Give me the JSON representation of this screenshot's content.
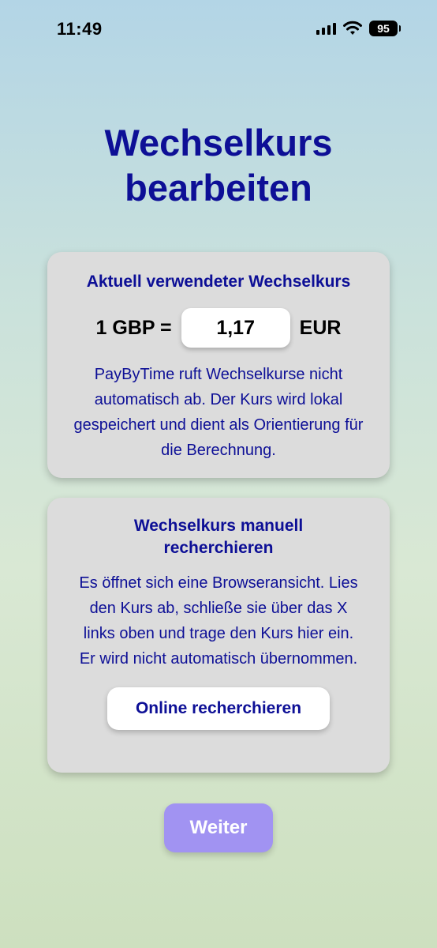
{
  "status_bar": {
    "time": "11:49",
    "battery": "95",
    "icons": [
      "signal-icon",
      "wifi-icon",
      "battery-icon"
    ]
  },
  "page": {
    "title_line1": "Wechselkurs",
    "title_line2": "bearbeiten"
  },
  "rate_card": {
    "heading": "Aktuell verwendeter Wechselkurs",
    "from_label": "1 GBP =",
    "rate_value": "1,17",
    "to_label": "EUR",
    "description": "PayByTime ruft Wechselkurse nicht automatisch ab. Der Kurs wird lokal gespeichert und dient als Orientierung für die Berechnung."
  },
  "research_card": {
    "heading": "Wechselkurs manuell recherchieren",
    "description": "Es öffnet sich eine Browseransicht. Lies den Kurs ab, schließe sie über das X links oben und trage den Kurs hier ein. Er wird nicht automatisch übernommen.",
    "button_label": "Online recherchieren"
  },
  "footer": {
    "next_label": "Weiter"
  },
  "colors": {
    "accent_text": "#0d0f96",
    "card_bg": "#dcdcdc",
    "next_button": "#a193f2"
  }
}
